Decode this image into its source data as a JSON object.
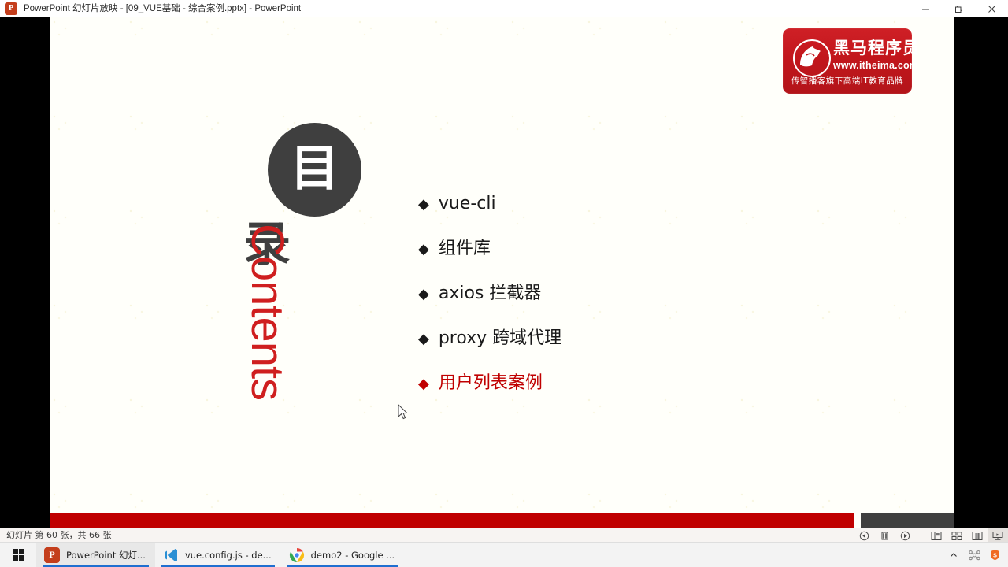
{
  "window": {
    "title": "PowerPoint 幻灯片放映 - [09_VUE基础 - 综合案例.pptx] - PowerPoint",
    "app_icon": "powerpoint-icon",
    "minimize_label": "最小化",
    "restore_label": "还原",
    "close_label": "关闭"
  },
  "slide": {
    "logo": {
      "brand_cn": "黑马程序员",
      "url": "www.itheima.com",
      "slogan": "传智播客旗下高端IT教育品牌",
      "brand_color": "#c2161c",
      "mark_icon": "horse-head-icon"
    },
    "badge": {
      "glyph": "目",
      "glyph_icon": "catalog-glyph-icon",
      "circle_color": "#3f3f3f"
    },
    "heading_cn": "录",
    "heading_en": "Contents",
    "heading_en_color": "#cf1f1f",
    "toc": [
      {
        "bullet": "◆",
        "label": "vue-cli",
        "accent": false
      },
      {
        "bullet": "◆",
        "label": "组件库",
        "accent": false
      },
      {
        "bullet": "◆",
        "label": "axios 拦截器",
        "accent": false
      },
      {
        "bullet": "◆",
        "label": "proxy 跨域代理",
        "accent": false
      },
      {
        "bullet": "◆",
        "label": "用户列表案例",
        "accent": true
      }
    ],
    "accent_color": "#c00000",
    "footer_bar_color": "#c00000"
  },
  "statusbar": {
    "slide_position": "幻灯片 第 60 张，共 66 张",
    "controls": [
      {
        "name": "previous-slide-button",
        "icon": "previous-icon"
      },
      {
        "name": "pause-button",
        "icon": "pause-icon"
      },
      {
        "name": "next-slide-button",
        "icon": "next-icon"
      },
      {
        "name": "normal-view-button",
        "icon": "normal-view-icon"
      },
      {
        "name": "slide-sorter-button",
        "icon": "grid-view-icon"
      },
      {
        "name": "reading-view-button",
        "icon": "reading-view-icon"
      },
      {
        "name": "slideshow-button",
        "icon": "slideshow-icon"
      }
    ]
  },
  "taskbar": {
    "start_label": "开始",
    "items": [
      {
        "label": "PowerPoint 幻灯...",
        "icon": "powerpoint-icon",
        "active": true
      },
      {
        "label": "vue.config.js - de...",
        "icon": "vscode-icon",
        "active": false
      },
      {
        "label": "demo2 - Google ...",
        "icon": "chrome-icon",
        "active": false
      }
    ],
    "tray": [
      {
        "name": "show-hidden-icons-button",
        "icon": "chevron-up-icon"
      },
      {
        "name": "tray-network-icon",
        "icon": "network-icon"
      },
      {
        "name": "tray-security-icon",
        "icon": "security-shield-icon"
      }
    ]
  }
}
